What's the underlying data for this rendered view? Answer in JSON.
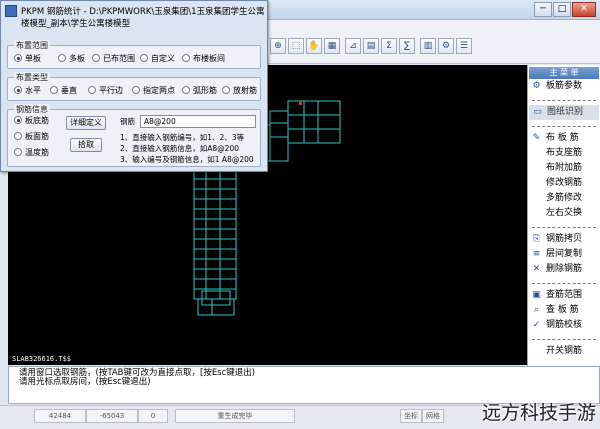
{
  "window": {
    "title": "PKPM 钢筋统计 - D:\\PKPMWORK\\玉泉集团\\1玉泉集团学生公寓楼模型_副本\\学生公寓楼模型",
    "minimize": "─",
    "maximize": "□",
    "close": "✕"
  },
  "dialog": {
    "title": "PKPM 钢筋统计 - D:\\PKPMWORK\\玉泉集团\\1玉泉集团学生公寓楼模型_副本\\学生公寓楼模型",
    "range": {
      "label": "布置范围",
      "options": [
        "单板",
        "多板",
        "已布范围",
        "自定义",
        "布楼板间"
      ],
      "selected": 0
    },
    "type": {
      "label": "布置类型",
      "options": [
        "水平",
        "垂直",
        "平行边",
        "指定两点",
        "弧形筋",
        "放射筋"
      ],
      "selected": 0
    },
    "rebar": {
      "label": "钢筋信息",
      "options": [
        "板底筋",
        "板面筋",
        "温度筋"
      ],
      "selected": 0,
      "detail_button": "详细定义",
      "pick_button": "拾取",
      "field_label": "钢筋",
      "field_value": "A8@200",
      "hints": [
        "1、直接输入钢筋编号，如1、2、3等",
        "2、直接输入钢筋信息，如A8@200",
        "3、输入编号及钢筋信息，如1 A8@200"
      ]
    }
  },
  "toolbar": {
    "icons": [
      "zoom-icon",
      "select-icon",
      "pan-icon",
      "grid-icon",
      "measure-icon",
      "table-icon",
      "sum-icon",
      "sigma-icon",
      "layer-icon",
      "settings-icon",
      "list-icon"
    ]
  },
  "sidebar": {
    "header": "主 菜 单",
    "items": [
      {
        "label": "板筋参数",
        "icon": "gear-icon"
      },
      {
        "sep": true
      },
      {
        "label": "图纸识别",
        "icon": "drawing-icon",
        "highlight": true
      },
      {
        "sep": true
      },
      {
        "label": "布 板 筋",
        "icon": "pencil-icon"
      },
      {
        "label": "布支座筋",
        "icon": ""
      },
      {
        "label": "布附加筋",
        "icon": ""
      },
      {
        "label": "修改钢筋",
        "icon": ""
      },
      {
        "label": "多筋修改",
        "icon": ""
      },
      {
        "label": "左右交换",
        "icon": ""
      },
      {
        "sep": true
      },
      {
        "label": "钢筋拷贝",
        "icon": "copy-icon"
      },
      {
        "label": "层间复制",
        "icon": "layers-icon"
      },
      {
        "label": "删除钢筋",
        "icon": "delete-icon"
      },
      {
        "sep": true
      },
      {
        "label": "查筋范围",
        "icon": "range-icon"
      },
      {
        "label": "查 板 筋",
        "icon": "search-icon"
      },
      {
        "label": "钢筋校核",
        "icon": "check-icon"
      },
      {
        "sep": true
      },
      {
        "label": "开关钢筋",
        "icon": ""
      }
    ]
  },
  "command_line": "SLAB326616.T$$",
  "command_history": [
    "请用窗口选取钢筋，(按TAB键可改为直接点取，[按Esc键退出)",
    "请用光标点取房间，(按Esc键退出)"
  ],
  "statusbar": {
    "x": "42484",
    "y": "-65043",
    "z": "0",
    "message": "重生成完毕",
    "right": [
      "坐标",
      "网格"
    ]
  },
  "watermark": "远方科技手游"
}
